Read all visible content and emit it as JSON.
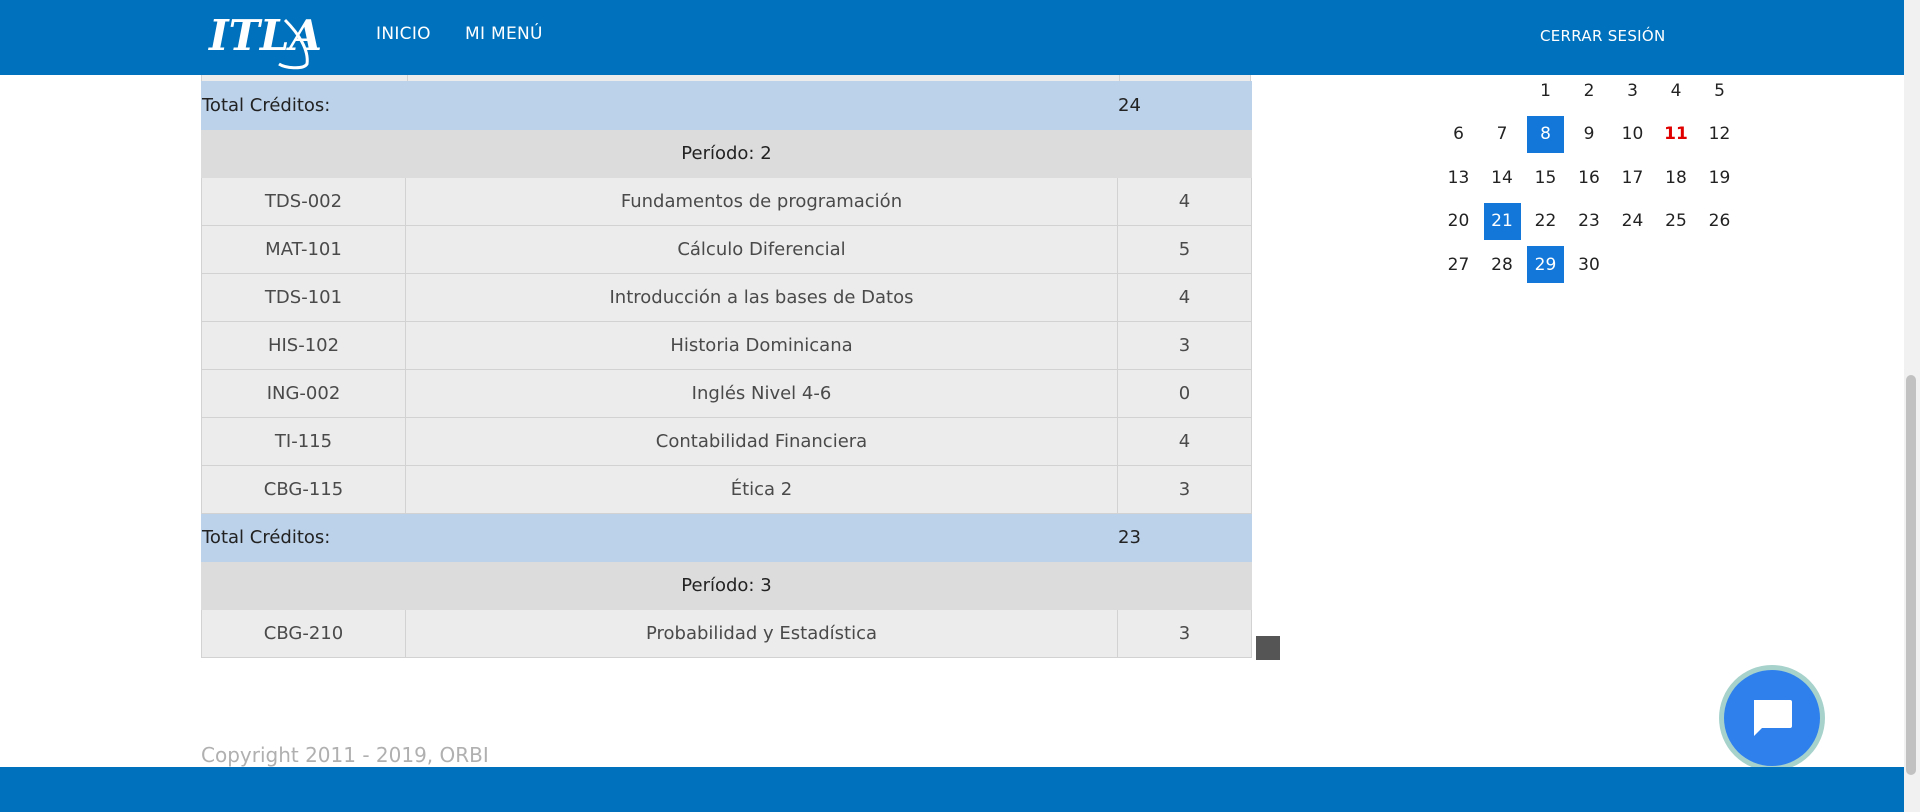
{
  "header": {
    "logo_text": "ITLA",
    "nav": [
      "INICIO",
      "MI MENÚ"
    ],
    "logout": "CERRAR SESIÓN"
  },
  "courses": {
    "total_label": "Total Créditos:",
    "total_period1": "24",
    "period2": {
      "title": "Período: 2",
      "rows": [
        {
          "code": "TDS-002",
          "name": "Fundamentos de programación",
          "credits": "4"
        },
        {
          "code": "MAT-101",
          "name": "Cálculo Diferencial",
          "credits": "5"
        },
        {
          "code": "TDS-101",
          "name": "Introducción a las bases de Datos",
          "credits": "4"
        },
        {
          "code": "HIS-102",
          "name": "Historia Dominicana",
          "credits": "3"
        },
        {
          "code": "ING-002",
          "name": "Inglés Nivel 4-6",
          "credits": "0"
        },
        {
          "code": "TI-115",
          "name": "Contabilidad Financiera",
          "credits": "4"
        },
        {
          "code": "CBG-115",
          "name": "Ética 2",
          "credits": "3"
        }
      ],
      "total": "23"
    },
    "period3": {
      "title": "Período: 3",
      "rows": [
        {
          "code": "CBG-210",
          "name": "Probabilidad y Estadística",
          "credits": "3"
        }
      ]
    }
  },
  "calendar": {
    "weeks": [
      [
        "",
        "",
        "1",
        "2",
        "3",
        "4",
        "5"
      ],
      [
        "6",
        "7",
        "8",
        "9",
        "10",
        "11",
        "12"
      ],
      [
        "13",
        "14",
        "15",
        "16",
        "17",
        "18",
        "19"
      ],
      [
        "20",
        "21",
        "22",
        "23",
        "24",
        "25",
        "26"
      ],
      [
        "27",
        "28",
        "29",
        "30",
        "",
        "",
        ""
      ]
    ],
    "selected_days": [
      "8",
      "21",
      "29"
    ],
    "today": "11",
    "selected_color": "#1277d9",
    "today_color": "#e00000"
  },
  "chat": {
    "icon": "chat-bubble-icon"
  },
  "footer": {
    "copyright": "Copyright 2011 - 2019, ORBI"
  },
  "colors": {
    "brand": "#0071bc",
    "total_row": "#bcd2ea",
    "period_row": "#dcdcdc"
  }
}
